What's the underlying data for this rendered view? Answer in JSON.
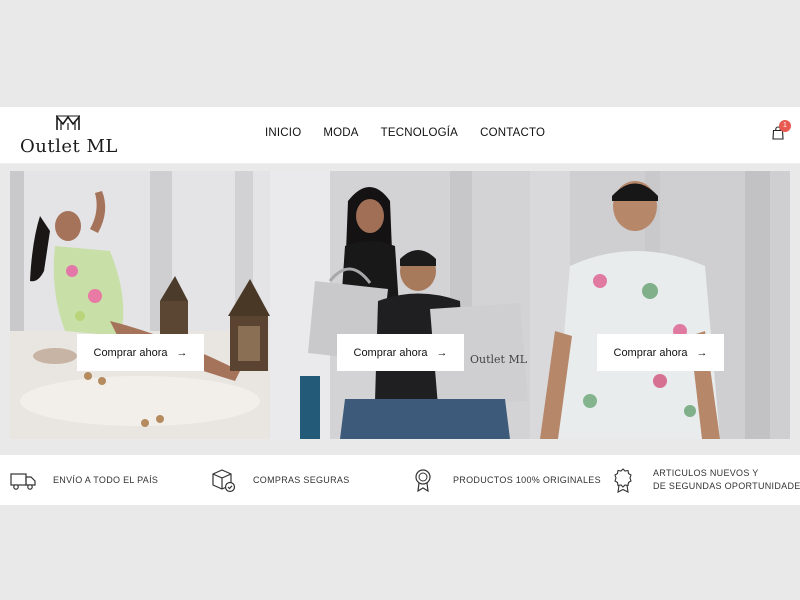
{
  "brand": {
    "name": "Outlet ML",
    "mark": "ML"
  },
  "nav": {
    "items": [
      "INICIO",
      "MODA",
      "TECNOLOGÍA",
      "CONTACTO"
    ]
  },
  "cart": {
    "count": "1",
    "badge_color": "#e85a4f"
  },
  "hero": {
    "cta_label": "Comprar ahora",
    "cta_arrow": "→",
    "bag_logo": "Outlet ML"
  },
  "features": [
    {
      "icon": "truck-icon",
      "text": "ENVÍO A TODO EL PAÍS"
    },
    {
      "icon": "secure-box-icon",
      "text": "COMPRAS SEGURAS"
    },
    {
      "icon": "medal-icon",
      "text": "PRODUCTOS 100% ORIGINALES"
    },
    {
      "icon": "award-icon",
      "line1": "ARTICULOS NUEVOS Y",
      "line2": "DE SEGUNDAS OPORTUNIDADES."
    }
  ]
}
